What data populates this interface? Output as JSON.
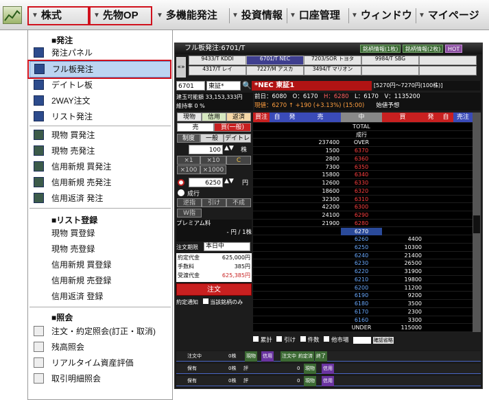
{
  "menubar": {
    "items": [
      {
        "label": "株式",
        "highlighted": true
      },
      {
        "label": "先物OP",
        "highlighted": true
      },
      {
        "label": "多機能発注"
      },
      {
        "label": "投資情報"
      },
      {
        "label": "口座管理"
      },
      {
        "label": "ウィンドウ"
      },
      {
        "label": "マイページ"
      }
    ]
  },
  "dropdown": {
    "sections": [
      {
        "title": "■発注",
        "items": [
          {
            "label": "発注パネル",
            "icon": "order-panel-icon"
          },
          {
            "label": "フル板発注",
            "icon": "full-board-icon",
            "selected": true
          },
          {
            "label": "デイトレ板",
            "icon": "daytrade-icon"
          },
          {
            "label": "2WAY注文",
            "icon": "twoway-icon"
          },
          {
            "label": "リスト発注",
            "icon": "list-order-icon"
          },
          {
            "label": "現物 買発注",
            "icon": "cash-buy-icon"
          },
          {
            "label": "現物 売発注",
            "icon": "cash-sell-icon"
          },
          {
            "label": "信用新規 買発注",
            "icon": "margin-buy-icon"
          },
          {
            "label": "信用新規 売発注",
            "icon": "margin-sell-icon"
          },
          {
            "label": "信用返済 発注",
            "icon": "margin-close-icon"
          }
        ]
      },
      {
        "title": "■リスト登録",
        "items": [
          {
            "label": "現物 買登録"
          },
          {
            "label": "現物 売登録"
          },
          {
            "label": "信用新規 買登録"
          },
          {
            "label": "信用新規 売登録"
          },
          {
            "label": "信用返済 登録"
          }
        ]
      },
      {
        "title": "■照会",
        "items": [
          {
            "label": "注文・約定照会(訂正・取消)",
            "icon": "inquiry-icon"
          },
          {
            "label": "残高照会",
            "icon": "balance-icon"
          },
          {
            "label": "リアルタイム資産評価",
            "icon": "asset-icon"
          },
          {
            "label": "取引明細照会",
            "icon": "statement-icon"
          }
        ]
      }
    ]
  },
  "panel": {
    "title": "フル板発注:6701/T",
    "hot": "HOT",
    "btn1": "銘柄情報(1枚)",
    "btn2": "銘柄情報(2枚)",
    "tabs_row1": [
      "9433/T\nKDDI",
      "6701/T\nNEC",
      "7203/SOR\nトヨタ",
      "9984/T\nSBG",
      ""
    ],
    "tabs_row2": [
      "4317/T\nレイ",
      "7227/M\nアスカ",
      "3494/T\nマリオン",
      "",
      ""
    ],
    "code": "6701",
    "market": "東証*",
    "stock_name": "*NEC 東証1",
    "limits": "[5270円〜7270円(100株)]",
    "buying_power_label": "建玉可能額",
    "buying_power": "33,153,333円",
    "margin_rate_label": "維持率",
    "margin_rate": "0 %",
    "prev_close": "前日：6080",
    "open": "O：6170",
    "high": "H：6280",
    "low": "L：6170",
    "volume": "V：1135200",
    "current": "現値：6270 ↑ +190 (+3.13%) (15:00)",
    "close_label": "始値予想",
    "tabs_left": [
      "現物",
      "信用",
      "返済"
    ],
    "sell_buy": [
      "売",
      "買(一般)"
    ],
    "kind": [
      "制度",
      "一般",
      "デイトレ"
    ],
    "qty": "100",
    "qty_unit": "株",
    "qty_btns": [
      "×1",
      "×10",
      "C",
      "×100",
      "×1000"
    ],
    "price": "6250",
    "price_unit": "円",
    "market_order": "成行",
    "cond_btns": [
      "逆指",
      "引け",
      "不成"
    ],
    "w_label": "W指",
    "premium_label": "プレミアム料",
    "premium_value": "- 円 / 1株",
    "term_label": "注文期限",
    "term_value": "本日中",
    "amount_label": "約定代金",
    "amount": "625,000円",
    "fee_label": "手数料",
    "fee": "385円",
    "total_label": "受渡代金",
    "total": "625,385円",
    "order_btn": "注文",
    "notify_label": "約定通知",
    "only_label": "当該銘柄のみ",
    "board_headers": [
      "買注",
      "自",
      "発",
      "売",
      "中",
      "買",
      "発",
      "自",
      "売注"
    ],
    "board_top": [
      {
        "sell": "",
        "price": "TOTAL",
        "buy": ""
      },
      {
        "sell": "",
        "price": "成行",
        "buy": ""
      },
      {
        "sell": "237400",
        "price": "OVER",
        "buy": ""
      }
    ],
    "board_asks": [
      {
        "sell": "1500",
        "price": "6370"
      },
      {
        "sell": "2800",
        "price": "6360"
      },
      {
        "sell": "7300",
        "price": "6350"
      },
      {
        "sell": "15800",
        "price": "6340"
      },
      {
        "sell": "12600",
        "price": "6330"
      },
      {
        "sell": "18600",
        "price": "6320"
      },
      {
        "sell": "32300",
        "price": "6310"
      },
      {
        "sell": "42200",
        "price": "6300"
      },
      {
        "sell": "24100",
        "price": "6290"
      },
      {
        "sell": "21900",
        "price": "6280"
      }
    ],
    "board_mid": "6270",
    "board_bids": [
      {
        "price": "6260",
        "buy": "4400"
      },
      {
        "price": "6250",
        "buy": "10300"
      },
      {
        "price": "6240",
        "buy": "21400"
      },
      {
        "price": "6230",
        "buy": "26500"
      },
      {
        "price": "6220",
        "buy": "31900"
      },
      {
        "price": "6210",
        "buy": "19800"
      },
      {
        "price": "6200",
        "buy": "11200"
      },
      {
        "price": "6190",
        "buy": "9200"
      },
      {
        "price": "6180",
        "buy": "3500"
      },
      {
        "price": "6170",
        "buy": "2300"
      },
      {
        "price": "6160",
        "buy": "3300"
      }
    ],
    "board_under": {
      "price": "UNDER",
      "buy": "115000"
    },
    "bottom_checks": [
      "累計",
      "引け",
      "件数",
      "他市場"
    ],
    "bottom_btn": "確認省略",
    "status_rows": [
      {
        "label": "注文中",
        "count": "0株",
        "t1": "現物",
        "t2": "信用",
        "t3": "注文中",
        "t4": "約定済",
        "t5": "終了"
      },
      {
        "label": "保有",
        "count": "0株",
        "t1": "評",
        "amount": "0",
        "t2": "現物",
        "t3": "信用"
      },
      {
        "label": "保有",
        "count": "0株",
        "t1": "評",
        "amount": "0",
        "t2": "現物",
        "t3": "信用"
      }
    ]
  }
}
